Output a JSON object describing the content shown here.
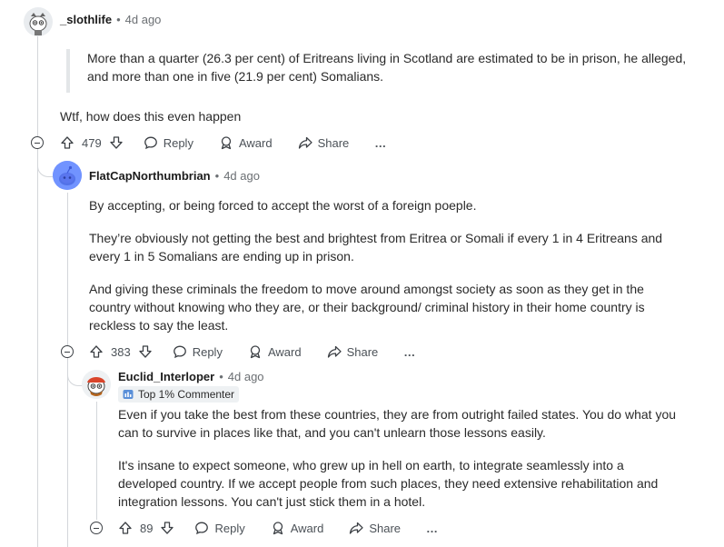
{
  "comments": [
    {
      "user": "_slothlife",
      "time": "4d ago",
      "quote": "More than a quarter (26.3 per cent) of Eritreans living in Scotland are estimated to be in prison, he alleged, and more than one in five (21.9 per cent) Somalians.",
      "text": "Wtf, how does this even happen",
      "votes": "479"
    },
    {
      "user": "FlatCapNorthumbrian",
      "time": "4d ago",
      "paragraphs": [
        "By accepting, or being forced to accept the worst of a foreign poeple.",
        "They’re obviously not getting the best and brightest from Eritrea or Somali if every 1 in 4 Eritreans and every 1 in 5 Somalians are ending up in prison.",
        "And giving these criminals the freedom to move around amongst society as soon as they get in the country without knowing who they are, or their background/ criminal history in their home country is reckless to say the least."
      ],
      "votes": "383"
    },
    {
      "user": "Euclid_Interloper",
      "time": "4d ago",
      "badge": "Top 1% Commenter",
      "paragraphs": [
        "Even if you take the best from these countries, they are from outright failed states. You do what you can to survive in places like that, and you can't unlearn those lessons easily.",
        "It's insane to expect someone, who grew up in hell on earth, to integrate seamlessly into a developed country. If we accept people from such places, they need extensive rehabilitation and integration lessons. You can't just stick them in a hotel."
      ],
      "votes": "89"
    }
  ],
  "actions": {
    "reply": "Reply",
    "award": "Award",
    "share": "Share",
    "more": "…"
  },
  "separator": "•",
  "colors": {
    "accent": "#0045ac",
    "line": "#d3d6da",
    "avatar_blue": "#7193ff"
  },
  "icons": [
    "upvote-icon",
    "downvote-icon",
    "reply-icon",
    "award-icon",
    "share-icon",
    "more-icon",
    "collapse-icon"
  ]
}
